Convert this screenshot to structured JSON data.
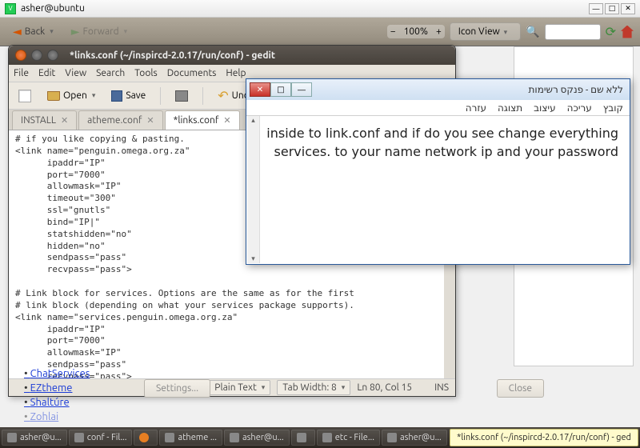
{
  "vnc": {
    "title": "asher@ubuntu"
  },
  "filemanager": {
    "back": "Back",
    "forward": "Forward",
    "zoom": "100%",
    "view": "Icon View"
  },
  "gedit": {
    "title": "*links.conf (~/inspircd-2.0.17/run/conf) - gedit",
    "menu": [
      "File",
      "Edit",
      "View",
      "Search",
      "Tools",
      "Documents",
      "Help"
    ],
    "toolbar": {
      "open": "Open",
      "save": "Save",
      "undo": "Undo"
    },
    "tabs": [
      {
        "label": "INSTALL",
        "active": false
      },
      {
        "label": "atheme.conf",
        "active": false
      },
      {
        "label": "*links.conf",
        "active": true
      }
    ],
    "content": "# if you like copying & pasting.\n<link name=\"penguin.omega.org.za\"\n      ipaddr=\"IP\"\n      port=\"7000\"\n      allowmask=\"IP\"\n      timeout=\"300\"\n      ssl=\"gnutls\"\n      bind=\"IP|\"\n      statshidden=\"no\"\n      hidden=\"no\"\n      sendpass=\"pass\"\n      recvpass=\"pass\">\n\n# Link block for services. Options are the same as for the first\n# link block (depending on what your services package supports).\n<link name=\"services.penguin.omega.org.za\"\n      ipaddr=\"IP\"\n      port=\"7000\"\n      allowmask=\"IP\"\n      sendpass=\"pass\"\n      recvpass=\"pass\">",
    "status": {
      "syntax": "Plain Text",
      "tabwidth": "Tab Width: 8",
      "position": "Ln 80, Col 15",
      "mode": "INS"
    }
  },
  "notepad": {
    "title": "ללא שם - פנקס רשימות",
    "menu": [
      "קובץ",
      "עריכה",
      "עיצוב",
      "תצוגה",
      "עזרה"
    ],
    "body": "inside to link.conf and if do you see change everything\nservices. to your name network ip and your password"
  },
  "links": [
    "ChatServices",
    "EZtheme",
    "Shaltúre",
    "Zohlai"
  ],
  "dialog": {
    "settings": "Settings...",
    "close": "Close"
  },
  "taskbar": {
    "items": [
      "asher@u...",
      "conf - Fil...",
      "",
      "atheme ...",
      "asher@u...",
      "",
      "etc - File...",
      "asher@u..."
    ],
    "tooltip": "*links.conf (~/inspircd-2.0.17/run/conf) - ged"
  }
}
